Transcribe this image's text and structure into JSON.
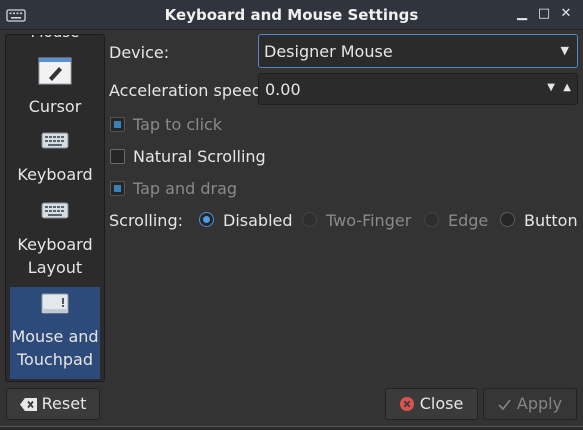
{
  "window": {
    "title": "Keyboard and Mouse Settings",
    "minimize_glyph": "▁",
    "maximize_glyph": "□",
    "close_glyph": "✕"
  },
  "sidebar": {
    "partial_top_label": "Mouse",
    "items": [
      {
        "label": "Cursor",
        "icon": "cursor-icon"
      },
      {
        "label": "Keyboard",
        "icon": "keyboard-icon"
      },
      {
        "label_line1": "Keyboard",
        "label_line2": "Layout",
        "icon": "keyboard-layout-icon"
      },
      {
        "label_line1": "Mouse and",
        "label_line2": "Touchpad",
        "icon": "touchpad-icon",
        "selected": true
      }
    ]
  },
  "device": {
    "label": "Device:",
    "value": "Designer Mouse"
  },
  "acceleration": {
    "label": "Acceleration speed:",
    "value": "0.00"
  },
  "options": {
    "tap_to_click": "Tap to click",
    "natural_scrolling": "Natural Scrolling",
    "tap_and_drag": "Tap and drag"
  },
  "scrolling": {
    "label": "Scrolling:",
    "choices": [
      "Disabled",
      "Two-Finger",
      "Edge",
      "Button"
    ],
    "selected": "Disabled"
  },
  "buttons": {
    "reset": "Reset",
    "close": "Close",
    "apply": "Apply"
  },
  "colors": {
    "accent": "#4a90d9",
    "selected_bg": "#2c4a7a",
    "close_icon": "#d9534f"
  }
}
